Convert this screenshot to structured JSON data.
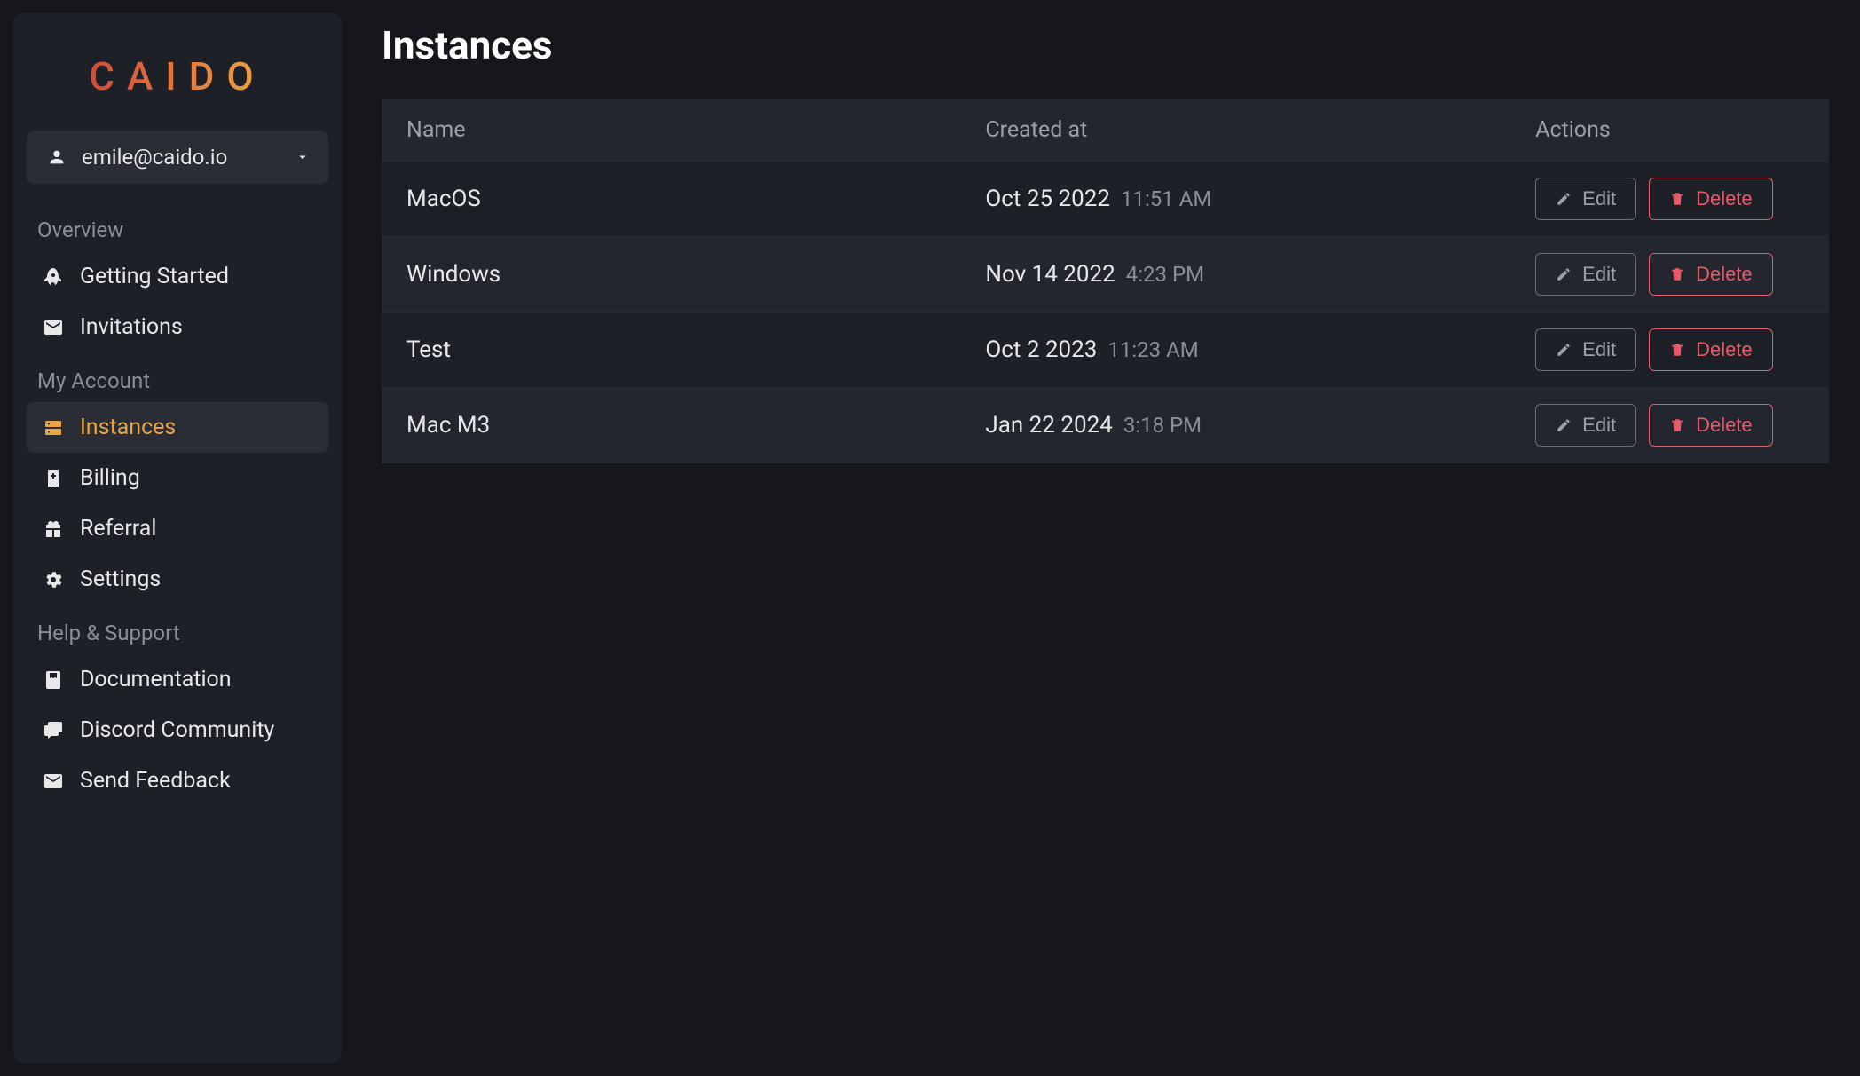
{
  "brand": "CAIDO",
  "account": {
    "email": "emile@caido.io"
  },
  "sidebar": {
    "sections": [
      {
        "label": "Overview",
        "items": [
          {
            "icon": "rocket",
            "label": "Getting Started",
            "active": false
          },
          {
            "icon": "envelope",
            "label": "Invitations",
            "active": false
          }
        ]
      },
      {
        "label": "My Account",
        "items": [
          {
            "icon": "server",
            "label": "Instances",
            "active": true
          },
          {
            "icon": "receipt",
            "label": "Billing",
            "active": false
          },
          {
            "icon": "gift",
            "label": "Referral",
            "active": false
          },
          {
            "icon": "gears",
            "label": "Settings",
            "active": false
          }
        ]
      },
      {
        "label": "Help & Support",
        "items": [
          {
            "icon": "book",
            "label": "Documentation",
            "active": false
          },
          {
            "icon": "comments",
            "label": "Discord Community",
            "active": false
          },
          {
            "icon": "envelope",
            "label": "Send Feedback",
            "active": false
          }
        ]
      }
    ]
  },
  "page": {
    "title": "Instances"
  },
  "table": {
    "columns": [
      "Name",
      "Created at",
      "Actions"
    ],
    "rows": [
      {
        "name": "MacOS",
        "date": "Oct 25 2022",
        "time": "11:51 AM"
      },
      {
        "name": "Windows",
        "date": "Nov 14 2022",
        "time": "4:23 PM"
      },
      {
        "name": "Test",
        "date": "Oct 2 2023",
        "time": "11:23 AM"
      },
      {
        "name": "Mac M3",
        "date": "Jan 22 2024",
        "time": "3:18 PM"
      }
    ],
    "actions": {
      "edit": "Edit",
      "delete": "Delete"
    }
  }
}
